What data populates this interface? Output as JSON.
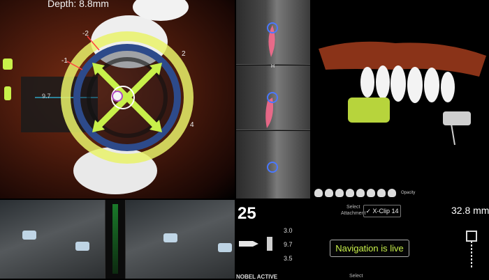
{
  "navigation_3d": {
    "depth_label": "Depth: 8.8mm",
    "ring_ticks": [
      "-2",
      "-1",
      "2",
      "4"
    ],
    "side_value": "9.7"
  },
  "ct_slices": {
    "slice_label": "H"
  },
  "status_panel": {
    "count": "25",
    "select_attachment_label_line1": "Select",
    "select_attachment_label_line2": "Attachment",
    "attachment_value": "✓  X-Clip 14",
    "distance": "32.8 mm",
    "implant_values": [
      "3.0",
      "9.7",
      "3.5"
    ],
    "status_message": "Navigation is live",
    "cutoff_label": "NOBEL ACTIVE",
    "bottom_select_label": "Select",
    "opacity_label": "Opacity"
  },
  "colors": {
    "accent_green": "#c8f04a",
    "target_ring": "#e9f26a",
    "navigation_blue": "#2d4a8a"
  }
}
